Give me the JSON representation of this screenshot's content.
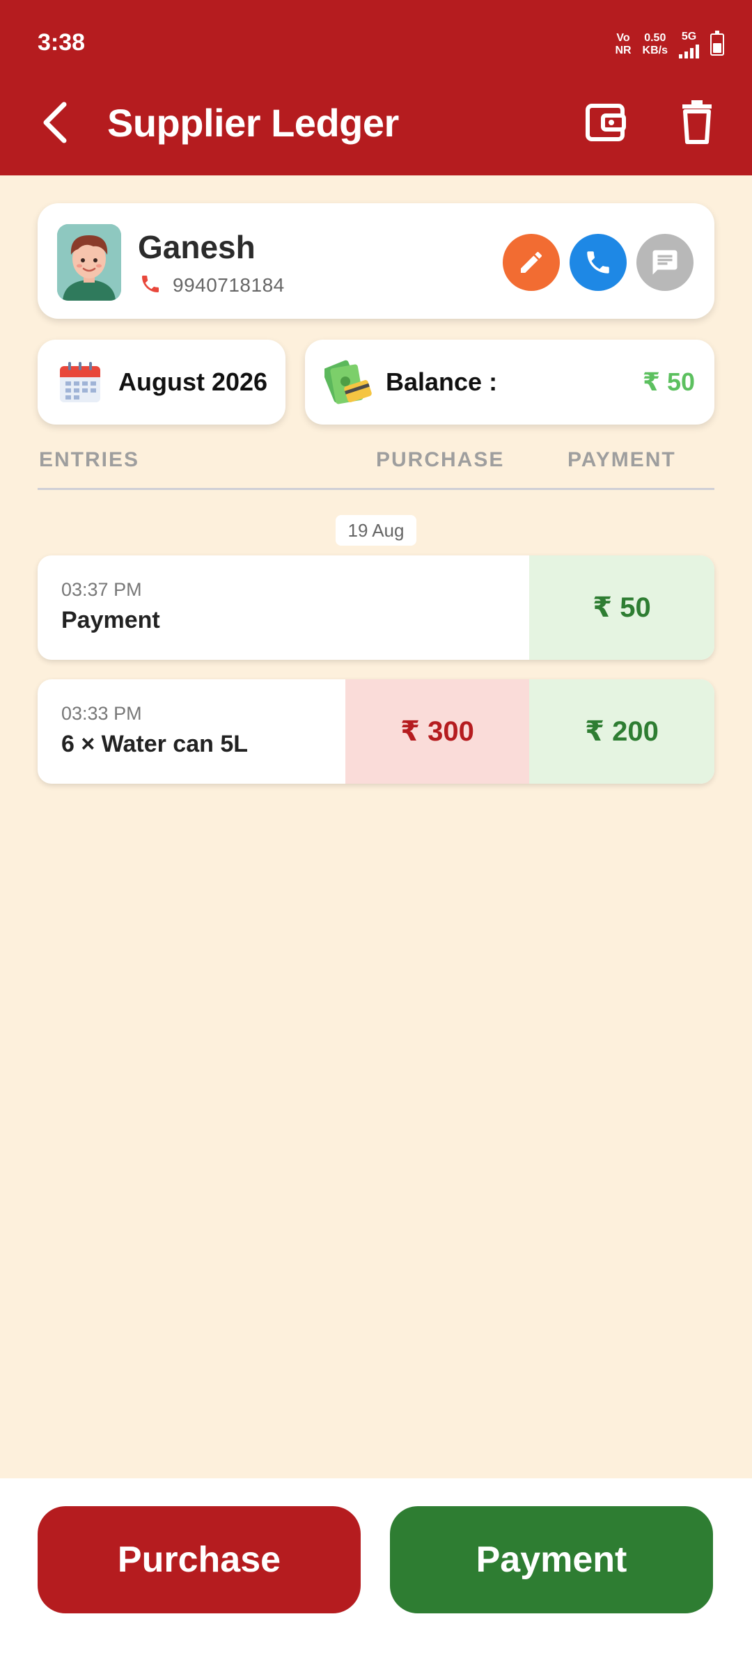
{
  "status_bar": {
    "time": "3:38",
    "network_top": "Vo",
    "network_bottom": "NR",
    "speed_value": "0.50",
    "speed_unit": "KB/s",
    "cell_label": "5G"
  },
  "header": {
    "title": "Supplier Ledger",
    "back_icon": "arrow-back-icon",
    "wallet_icon": "wallet-icon",
    "delete_icon": "delete-icon"
  },
  "supplier": {
    "name": "Ganesh",
    "phone": "9940718184"
  },
  "summary": {
    "month": "August 2026",
    "balance_label": "Balance :",
    "balance_value": "₹ 50"
  },
  "columns": {
    "entries": "ENTRIES",
    "purchase": "PURCHASE",
    "payment": "PAYMENT"
  },
  "date_group": "19 Aug",
  "entries": [
    {
      "time": "03:37 PM",
      "title": "Payment",
      "purchase": "",
      "payment": "₹ 50"
    },
    {
      "time": "03:33 PM",
      "title": "6 × Water can 5L",
      "purchase": "₹ 300",
      "payment": "₹ 200"
    }
  ],
  "actions": {
    "purchase_label": "Purchase",
    "payment_label": "Payment"
  },
  "colors": {
    "primary_red": "#b51c1f",
    "primary_green": "#2e7d32",
    "background": "#fdf0dc",
    "balance_green": "#5cc05f",
    "edit_orange": "#f26c32",
    "call_blue": "#1e88e5",
    "message_grey": "#b8b8b8"
  }
}
